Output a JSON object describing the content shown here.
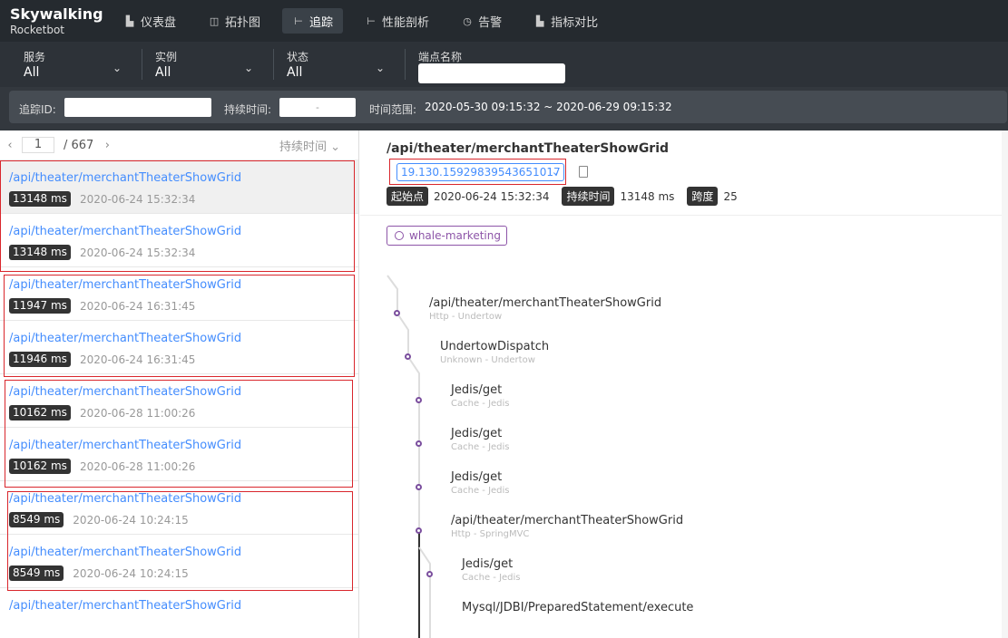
{
  "nav": {
    "logo_line1": "Skywalking",
    "logo_line2": "Rocketbot",
    "items": [
      {
        "label": "仪表盘",
        "icon": "dashboard-icon",
        "glyph": "▙"
      },
      {
        "label": "拓扑图",
        "icon": "topology-icon",
        "glyph": "◫"
      },
      {
        "label": "追踪",
        "icon": "trace-icon",
        "glyph": "⊢"
      },
      {
        "label": "性能剖析",
        "icon": "profile-icon",
        "glyph": "⊢"
      },
      {
        "label": "告警",
        "icon": "alarm-icon",
        "glyph": "◷"
      },
      {
        "label": "指标对比",
        "icon": "compare-icon",
        "glyph": "▙"
      }
    ]
  },
  "filters": {
    "service": {
      "label": "服务",
      "value": "All"
    },
    "instance": {
      "label": "实例",
      "value": "All"
    },
    "state": {
      "label": "状态",
      "value": "All"
    },
    "endpoint": {
      "label": "端点名称",
      "value": ""
    }
  },
  "search": {
    "trace_id_label": "追踪ID:",
    "trace_id_value": "",
    "duration_label": "持续时间:",
    "duration_value": "-",
    "time_range_label": "时间范围:",
    "time_range_value": "2020-05-30 09:15:32 ~ 2020-06-29 09:15:32"
  },
  "pager": {
    "page": "1",
    "total": "/ 667",
    "sort_label": "持续时间"
  },
  "traces": [
    {
      "name": "/api/theater/merchantTheaterShowGrid",
      "duration": "13148 ms",
      "time": "2020-06-24 15:32:34"
    },
    {
      "name": "/api/theater/merchantTheaterShowGrid",
      "duration": "13148 ms",
      "time": "2020-06-24 15:32:34"
    },
    {
      "name": "/api/theater/merchantTheaterShowGrid",
      "duration": "11947 ms",
      "time": "2020-06-24 16:31:45"
    },
    {
      "name": "/api/theater/merchantTheaterShowGrid",
      "duration": "11946 ms",
      "time": "2020-06-24 16:31:45"
    },
    {
      "name": "/api/theater/merchantTheaterShowGrid",
      "duration": "10162 ms",
      "time": "2020-06-28 11:00:26"
    },
    {
      "name": "/api/theater/merchantTheaterShowGrid",
      "duration": "10162 ms",
      "time": "2020-06-28 11:00:26"
    },
    {
      "name": "/api/theater/merchantTheaterShowGrid",
      "duration": "8549 ms",
      "time": "2020-06-24 10:24:15"
    },
    {
      "name": "/api/theater/merchantTheaterShowGrid",
      "duration": "8549 ms",
      "time": "2020-06-24 10:24:15"
    },
    {
      "name": "/api/theater/merchantTheaterShowGrid",
      "duration": "",
      "time": ""
    }
  ],
  "detail": {
    "title": "/api/theater/merchantTheaterShowGrid",
    "trace_id": "19.130.15929839543651017",
    "start_label": "起始点",
    "start_value": "2020-06-24 15:32:34",
    "duration_label": "持续时间",
    "duration_value": "13148 ms",
    "span_label": "跨度",
    "span_value": "25",
    "service_tag": "whale-marketing",
    "spans": [
      {
        "name": "/api/theater/merchantTheaterShowGrid",
        "sub": "Http - Undertow"
      },
      {
        "name": "UndertowDispatch",
        "sub": "Unknown - Undertow"
      },
      {
        "name": "Jedis/get",
        "sub": "Cache - Jedis"
      },
      {
        "name": "Jedis/get",
        "sub": "Cache - Jedis"
      },
      {
        "name": "Jedis/get",
        "sub": "Cache - Jedis"
      },
      {
        "name": "/api/theater/merchantTheaterShowGrid",
        "sub": "Http - SpringMVC"
      },
      {
        "name": "Jedis/get",
        "sub": "Cache - Jedis"
      },
      {
        "name": "Mysql/JDBI/PreparedStatement/execute",
        "sub": ""
      }
    ]
  }
}
